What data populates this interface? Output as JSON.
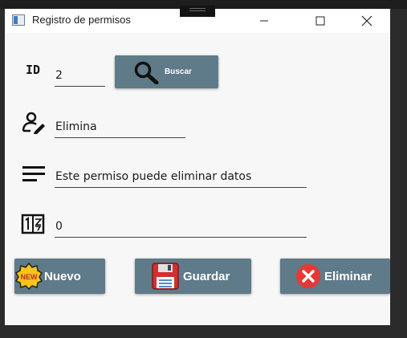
{
  "window": {
    "title": "Registro de permisos",
    "controls": {
      "minimize": "minimize",
      "maximize": "maximize",
      "close": "close"
    }
  },
  "form": {
    "id_label": "ID",
    "id_value": "2",
    "name_value": "Elimina",
    "description_value": "Este permiso puede eliminar datos",
    "number_value": "0"
  },
  "buttons": {
    "search_label": "Buscar",
    "new_label": "Nuevo",
    "save_label": "Guardar",
    "delete_label": "Eliminar"
  },
  "colors": {
    "button_bg": "#5f7a88",
    "window_bg": "#f7f7f7",
    "delete_red": "#e53935",
    "save_red": "#d32f2f",
    "new_badge": "#f5c518"
  },
  "icons": [
    "app-icon",
    "minimize-icon",
    "maximize-icon",
    "close-icon",
    "search-icon",
    "user-edit-icon",
    "text-lines-icon",
    "number-icon",
    "new-badge-icon",
    "floppy-disk-icon",
    "delete-x-icon"
  ]
}
